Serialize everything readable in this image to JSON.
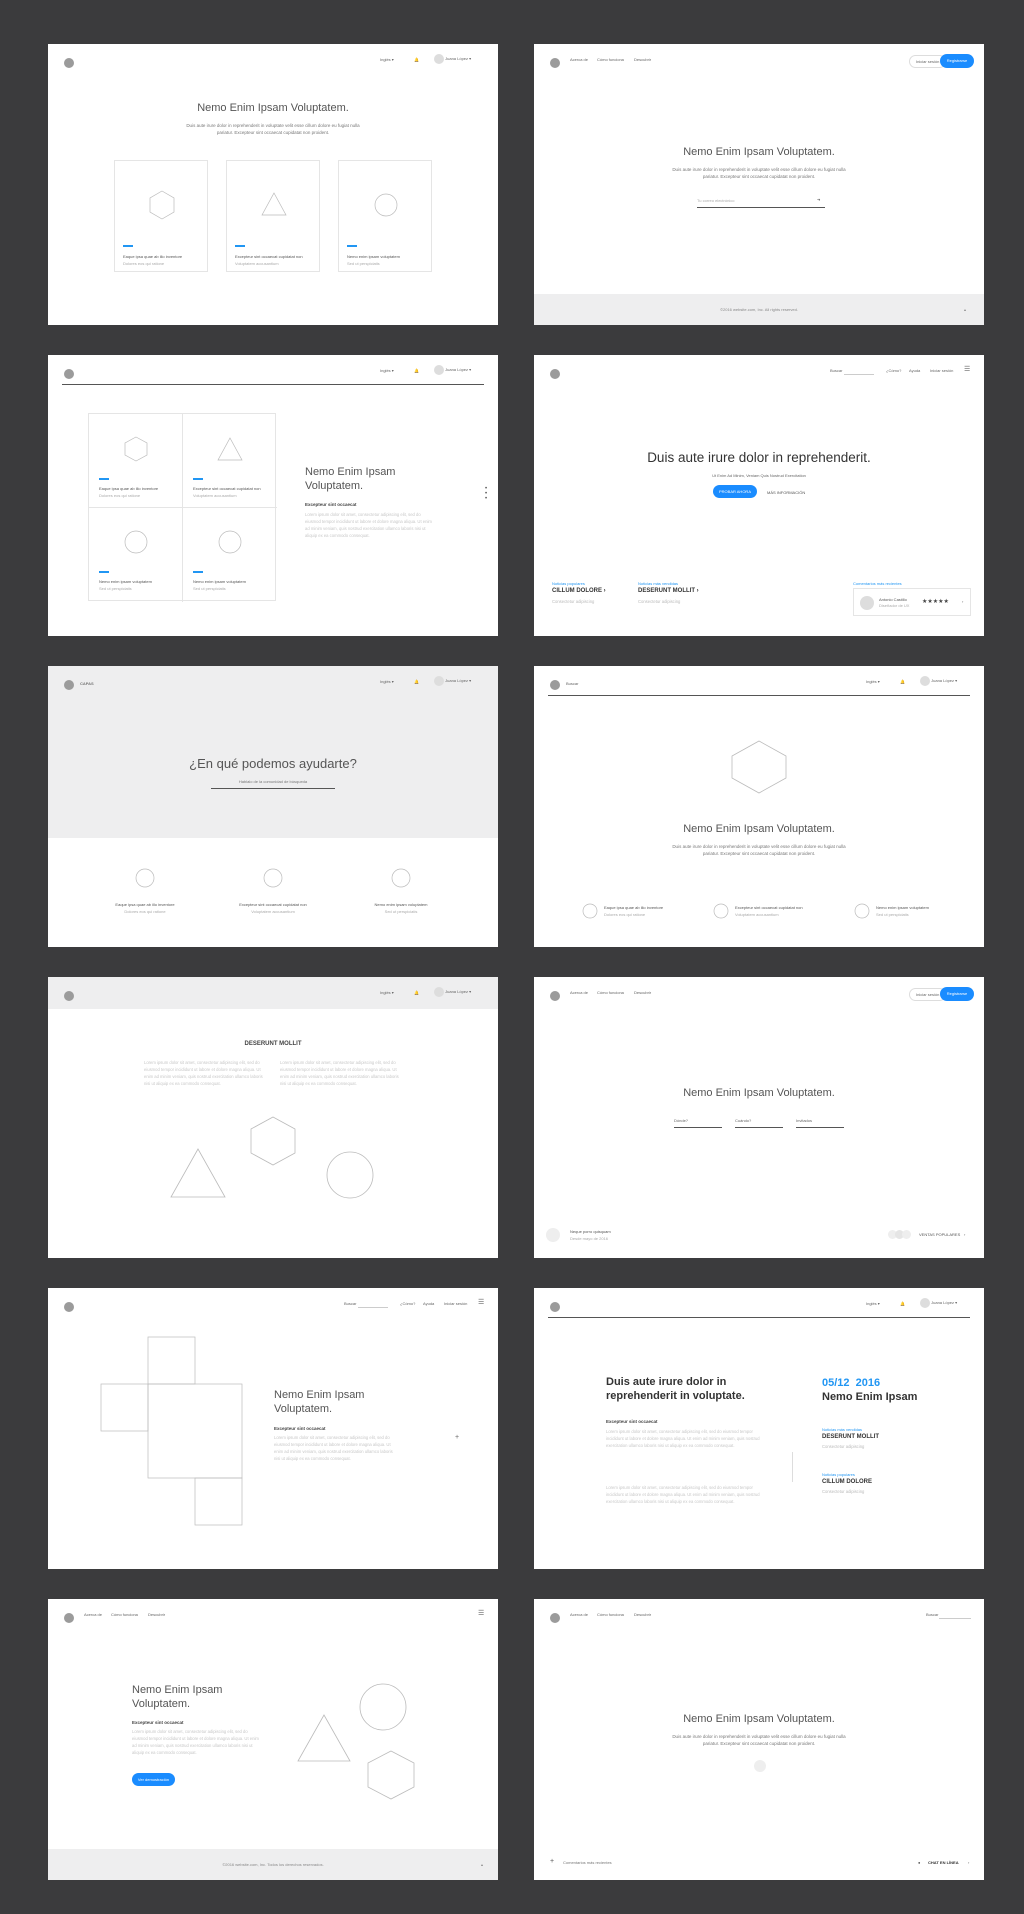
{
  "nav": {
    "language": "Inglés",
    "user": "Juana López",
    "about": "Acerca de",
    "how": "Cómo funciona",
    "discover": "Descubrir",
    "login": "Iniciar sesión",
    "register": "Registrarse",
    "search": "Buscar",
    "how_q": "¿Cómo?",
    "help": "Ayuda"
  },
  "heading": "Nemo Enim Ipsam Voluptatem.",
  "heading_line1": "Nemo Enim Ipsam",
  "heading_line2": "Voluptatem.",
  "desc_line1": "Duis aute irure dolor in reprehenderit in voluptate velit esse cillum dolore eu fugiat nulla",
  "desc_line2": "pariatur. Excepteur sint occaecat cupidatat non proident.",
  "cards": [
    {
      "title": "Eaque ipsa quae ab illo inventore",
      "sub": "Dolores eos qui ratione"
    },
    {
      "title": "Excepteur sint occaecat cupidatat non",
      "sub": "Voluptatem accusantium"
    },
    {
      "title": "Nemo enim ipsam voluptatem",
      "sub": "Sed ut perspiciatis"
    }
  ],
  "email_placeholder": "Tu correo electrónico",
  "footer_copy": "©2016 website.com, Inc. All rights reserved.",
  "footer_copy_es": "©2016 website.com, Inc. Todos los derechos reservados.",
  "subtitle": "Excepteur sint occaecat",
  "lorem": "Lorem ipsum dolor sit amet, consectetur adipiscing elit, sed do eiusmod tempor incididunt ut labore et dolore magna aliqua. Ut enim ad minim veniam, quis nostrud exercitation ullamco laboris nisi ut aliquip ex ea commodo consequat.",
  "hero": {
    "title": "Duis aute irure dolor in reprehenderit.",
    "sub": "Ut Enim Ad Minim, Veniam Quis Nostrud Exercitation",
    "try": "PROBAR AHORA",
    "more": "MÁS INFORMACIÓN"
  },
  "popular": {
    "label1": "Noticias populares",
    "item1": "CILLUM DOLORE",
    "label2": "Noticias más vendidas",
    "item2": "DESERUNT MOLLIT",
    "label3": "Comentarios más recientes",
    "user": "Antonio Castillo",
    "sub": "Consectetur adipiscing",
    "user_sub": "Diseñador de UX",
    "stars": "★★★★★"
  },
  "capas": "CAPAS",
  "help_title": "¿En qué podemos ayudarte?",
  "help_placeholder": "Hablalo de la comunidad de búsqueda",
  "deserunt": "DESERUNT MOLLIT",
  "form": {
    "f1": "Dónde?",
    "f2": "Cuándo?",
    "f3": "Invitados"
  },
  "neque": "Neque porro quisquam",
  "neque_sub": "Desde mayo de 2016",
  "ventas": "VENTAS POPULARES",
  "date": "05/12  2016",
  "duis": "Duis aute irure dolor in reprehenderit in voluptate.",
  "demo": "Ver demostración",
  "chat": "CHAT EN LÍNEA",
  "comments": "Comentarios más recientes",
  "colors": {
    "accent": "#1a8cff",
    "bg": "#3b3b3d",
    "panel": "#eeeeef"
  }
}
